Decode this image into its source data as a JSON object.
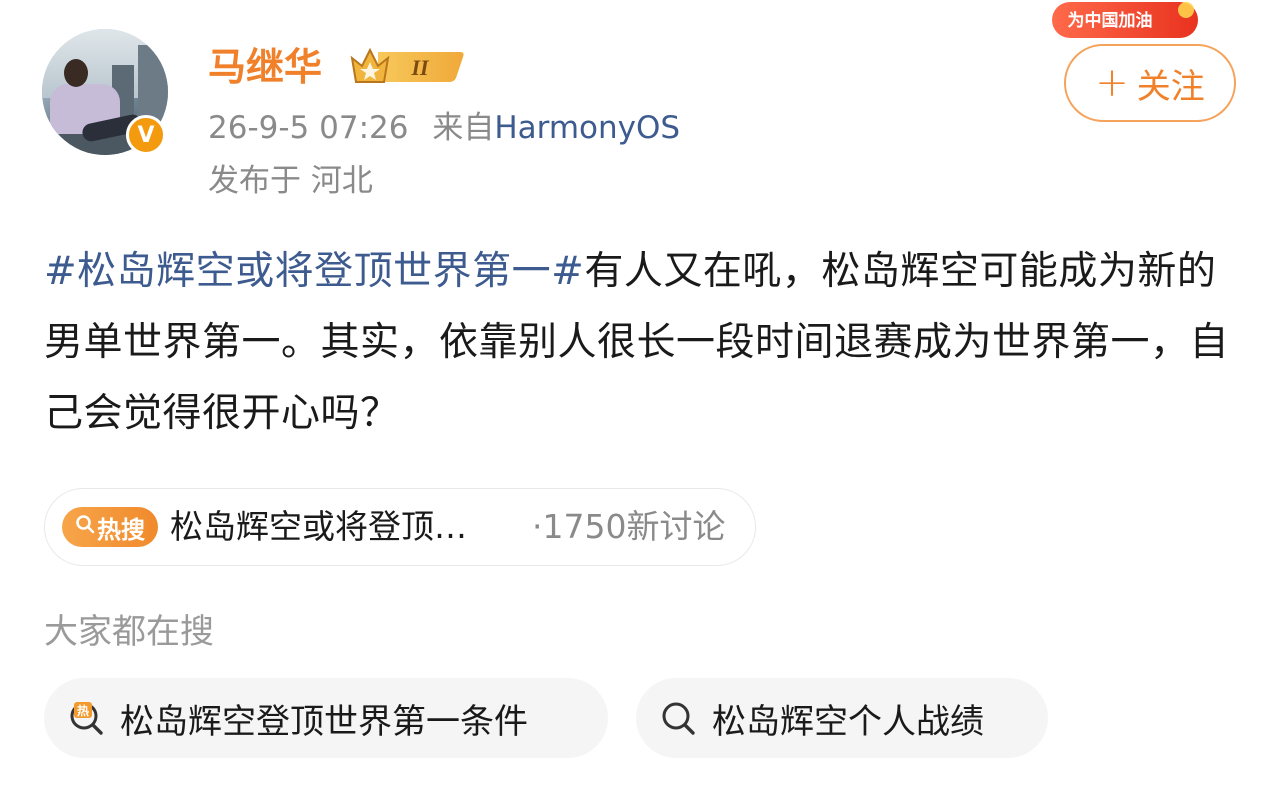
{
  "user": {
    "name": "马继华",
    "vip_level": "II",
    "verified_mark": "V",
    "avatar_icon": "avatar-photo"
  },
  "meta": {
    "time": "26-9-5 07:26",
    "source_prefix": "来自",
    "device": "HarmonyOS",
    "location": "发布于 河北"
  },
  "cheer_badge": "为中国加油",
  "follow_button": {
    "plus": "+",
    "label": "关注"
  },
  "post": {
    "hashtag": "#松岛辉空或将登顶世界第一#",
    "body": "有人又在吼，松岛辉空可能成为新的男单世界第一。其实，依靠别人很长一段时间退赛成为世界第一，自己会觉得很开心吗？"
  },
  "hot_search": {
    "tag": "热搜",
    "topic": "松岛辉空或将登顶…",
    "count": "·1750新讨论"
  },
  "everyone_search": {
    "title": "大家都在搜",
    "items": [
      {
        "icon": "hot-search-icon",
        "label": "松岛辉空登顶世界第一条件"
      },
      {
        "icon": "search-icon",
        "label": "松岛辉空个人战绩"
      }
    ]
  },
  "colors": {
    "accent": "#f0812a",
    "link": "#3d5b8f",
    "muted": "#8a8a8a"
  }
}
